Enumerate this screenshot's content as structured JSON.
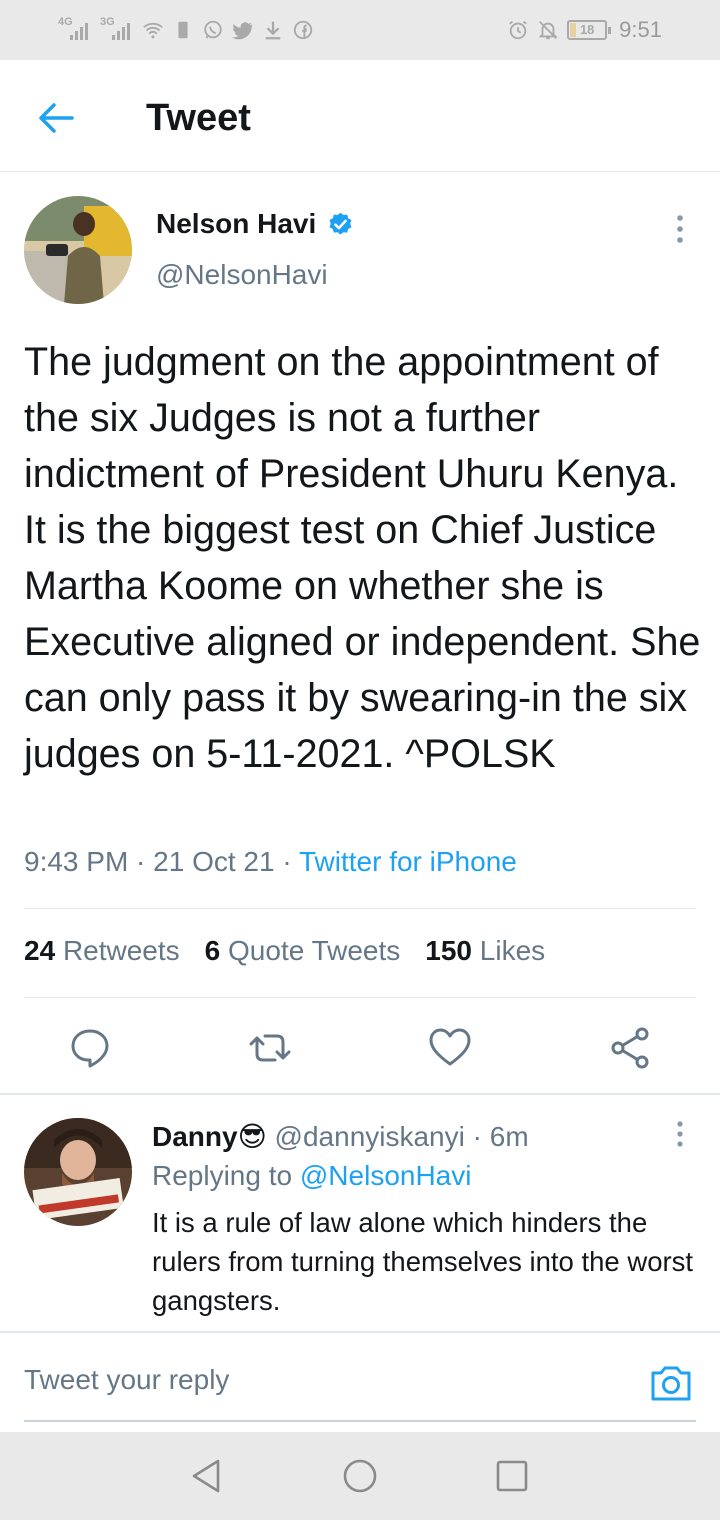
{
  "status_bar": {
    "signal_1": "4G",
    "signal_2": "3G",
    "battery": "18",
    "time": "9:51"
  },
  "header": {
    "title": "Tweet"
  },
  "tweet": {
    "author_name": "Nelson Havi",
    "author_handle": "@NelsonHavi",
    "text": "The judgment on the appointment of the six Judges is not a further indictment of President Uhuru Kenya. It is the biggest test on Chief Justice Martha Koome on whether she is Executive aligned or independent. She can only pass it by swearing-in the six judges on 5-11-2021. ^POLSK",
    "time": "9:43 PM",
    "date": "21 Oct 21",
    "separator": " · ",
    "source": "Twitter for iPhone",
    "stats": {
      "retweets_count": "24",
      "retweets_label": "Retweets",
      "quotes_count": "6",
      "quotes_label": "Quote Tweets",
      "likes_count": "150",
      "likes_label": "Likes"
    }
  },
  "reply": {
    "name": "Danny😎",
    "handle": "@dannyiskanyi",
    "age": "6m",
    "replying_prefix": "Replying to",
    "replying_to": "@NelsonHavi",
    "text": "It is a rule of law alone which hinders the rulers from turning themselves into the worst gangsters."
  },
  "compose": {
    "placeholder": "Tweet your reply"
  },
  "colors": {
    "accent": "#1da1f2",
    "text_primary": "#14171a",
    "text_secondary": "#657786",
    "divider": "#e1e8ed",
    "system_bar": "#e9e9e9"
  },
  "icons": {
    "back": "arrow-left-icon",
    "verified": "verified-badge-icon",
    "more": "more-vertical-icon",
    "reply": "reply-icon",
    "retweet": "retweet-icon",
    "like": "heart-icon",
    "share": "share-icon",
    "camera": "camera-icon",
    "nav_back": "triangle-back-icon",
    "nav_home": "circle-home-icon",
    "nav_recents": "square-recents-icon"
  }
}
